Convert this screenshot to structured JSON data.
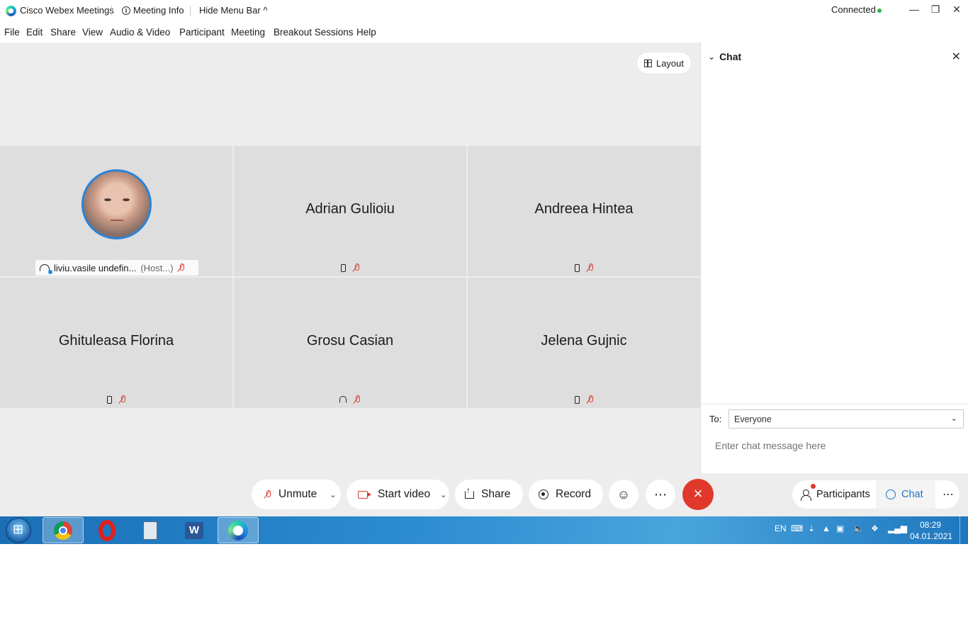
{
  "titlebar": {
    "app_name": "Cisco Webex Meetings",
    "meeting_info": "Meeting Info",
    "hide_menu_bar": "Hide Menu Bar",
    "status": "Connected"
  },
  "menu": [
    "File",
    "Edit",
    "Share",
    "View",
    "Audio & Video",
    "Participant",
    "Meeting",
    "Breakout Sessions",
    "Help"
  ],
  "layout_button": "Layout",
  "participants": [
    {
      "name": "liviu.vasile undefin...",
      "role": "(Host...)",
      "device": "share"
    },
    {
      "name": "Adrian Gulioiu",
      "device": "phone"
    },
    {
      "name": "Andreea Hintea",
      "device": "phone"
    },
    {
      "name": "Ghituleasa Florina",
      "device": "phone"
    },
    {
      "name": "Grosu Casian",
      "device": "headset"
    },
    {
      "name": "Jelena Gujnic",
      "device": "phone"
    }
  ],
  "controls": {
    "unmute": "Unmute",
    "start_video": "Start video",
    "share": "Share",
    "record": "Record",
    "more": "⋯",
    "end": "×"
  },
  "chat": {
    "title": "Chat",
    "to_label": "To:",
    "to_value": "Everyone",
    "placeholder": "Enter chat message here"
  },
  "bottom_right": {
    "participants": "Participants",
    "chat": "Chat",
    "more": "⋯"
  },
  "taskbar": {
    "language": "EN",
    "time": "08:29",
    "date": "04.01.2021"
  },
  "colors": {
    "accent": "#1d73c9",
    "end_call": "#e0392b",
    "muted": "#d63a2e",
    "connected": "#2bb34a"
  }
}
